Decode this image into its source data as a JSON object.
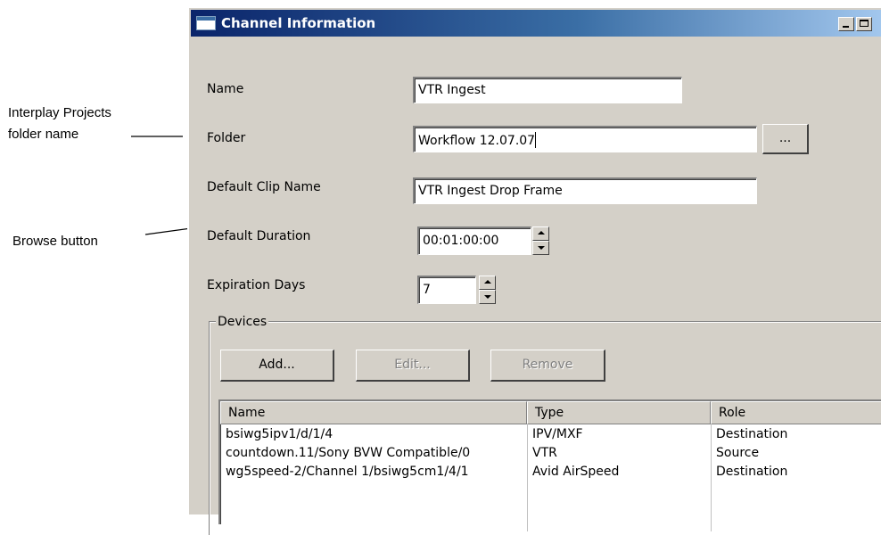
{
  "callouts": {
    "folder_line1": "Interplay Projects",
    "folder_line2": "folder name",
    "browse": "Browse button"
  },
  "window": {
    "title": "Channel Information"
  },
  "form": {
    "name_label": "Name",
    "name_value": "VTR Ingest",
    "folder_label": "Folder",
    "folder_value": "Workflow 12.07.07",
    "browse_label": "...",
    "clip_label": "Default Clip Name",
    "clip_value": "VTR Ingest Drop Frame",
    "duration_label": "Default Duration",
    "duration_value": "00:01:00:00",
    "expiration_label": "Expiration Days",
    "expiration_value": "7"
  },
  "devices": {
    "group_title": "Devices",
    "add_label": "Add...",
    "edit_label": "Edit...",
    "remove_label": "Remove",
    "columns": [
      "Name",
      "Type",
      "Role"
    ],
    "rows": [
      [
        "bsiwg5ipv1/d/1/4",
        "IPV/MXF",
        "Destination"
      ],
      [
        "countdown.11/Sony BVW Compatible/0",
        "VTR",
        "Source"
      ],
      [
        "wg5speed-2/Channel 1/bsiwg5cm1/4/1",
        "Avid AirSpeed",
        "Destination"
      ]
    ]
  }
}
